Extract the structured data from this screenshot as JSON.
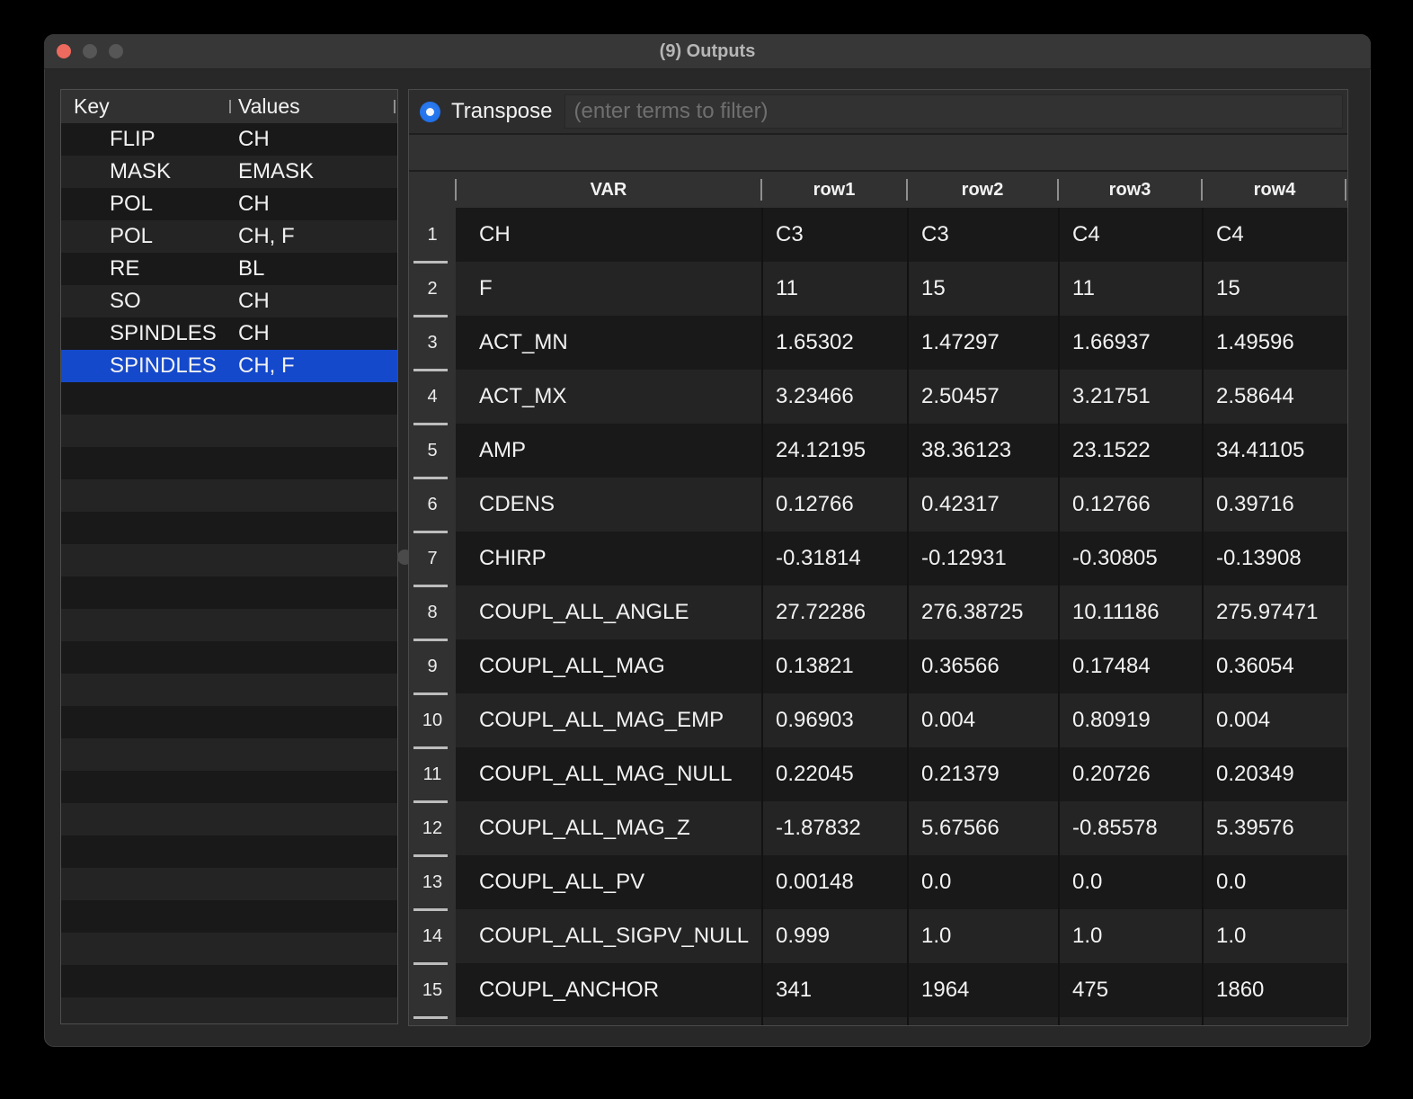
{
  "window": {
    "title": "(9) Outputs"
  },
  "left_panel": {
    "columns": [
      "Key",
      "Values"
    ],
    "rows": [
      {
        "key": "FLIP",
        "values": "CH",
        "selected": false
      },
      {
        "key": "MASK",
        "values": "EMASK",
        "selected": false
      },
      {
        "key": "POL",
        "values": "CH",
        "selected": false
      },
      {
        "key": "POL",
        "values": "CH, F",
        "selected": false
      },
      {
        "key": "RE",
        "values": "BL",
        "selected": false
      },
      {
        "key": "SO",
        "values": "CH",
        "selected": false
      },
      {
        "key": "SPINDLES",
        "values": "CH",
        "selected": false
      },
      {
        "key": "SPINDLES",
        "values": "CH, F",
        "selected": true
      }
    ]
  },
  "toolbar": {
    "transpose_label": "Transpose",
    "transpose_selected": true,
    "filter_value": "",
    "filter_placeholder": "(enter terms to filter)"
  },
  "table": {
    "columns": [
      "VAR",
      "row1",
      "row2",
      "row3",
      "row4"
    ],
    "rows": [
      {
        "n": "1",
        "var": "CH",
        "values": [
          "C3",
          "C3",
          "C4",
          "C4"
        ]
      },
      {
        "n": "2",
        "var": "F",
        "values": [
          "11",
          "15",
          "11",
          "15"
        ]
      },
      {
        "n": "3",
        "var": "ACT_MN",
        "values": [
          "1.65302",
          "1.47297",
          "1.66937",
          "1.49596"
        ]
      },
      {
        "n": "4",
        "var": "ACT_MX",
        "values": [
          "3.23466",
          "2.50457",
          "3.21751",
          "2.58644"
        ]
      },
      {
        "n": "5",
        "var": "AMP",
        "values": [
          "24.12195",
          "38.36123",
          "23.1522",
          "34.41105"
        ]
      },
      {
        "n": "6",
        "var": "CDENS",
        "values": [
          "0.12766",
          "0.42317",
          "0.12766",
          "0.39716"
        ]
      },
      {
        "n": "7",
        "var": "CHIRP",
        "values": [
          "-0.31814",
          "-0.12931",
          "-0.30805",
          "-0.13908"
        ]
      },
      {
        "n": "8",
        "var": "COUPL_ALL_ANGLE",
        "values": [
          "27.72286",
          "276.38725",
          "10.11186",
          "275.97471"
        ]
      },
      {
        "n": "9",
        "var": "COUPL_ALL_MAG",
        "values": [
          "0.13821",
          "0.36566",
          "0.17484",
          "0.36054"
        ]
      },
      {
        "n": "10",
        "var": "COUPL_ALL_MAG_EMP",
        "values": [
          "0.96903",
          "0.004",
          "0.80919",
          "0.004"
        ]
      },
      {
        "n": "11",
        "var": "COUPL_ALL_MAG_NULL",
        "values": [
          "0.22045",
          "0.21379",
          "0.20726",
          "0.20349"
        ]
      },
      {
        "n": "12",
        "var": "COUPL_ALL_MAG_Z",
        "values": [
          "-1.87832",
          "5.67566",
          "-0.85578",
          "5.39576"
        ]
      },
      {
        "n": "13",
        "var": "COUPL_ALL_PV",
        "values": [
          "0.00148",
          "0.0",
          "0.0",
          "0.0"
        ]
      },
      {
        "n": "14",
        "var": "COUPL_ALL_SIGPV_NULL",
        "values": [
          "0.999",
          "1.0",
          "1.0",
          "1.0"
        ]
      },
      {
        "n": "15",
        "var": "COUPL_ANCHOR",
        "values": [
          "341",
          "1964",
          "475",
          "1860"
        ]
      }
    ]
  },
  "colors": {
    "selection_blue": "#1549cb",
    "radio_blue": "#1c6ce8",
    "close_red": "#ec6a5e",
    "window_bg": "#282828",
    "titlebar_bg": "#373737",
    "header_bg": "#313131",
    "row_dark": "#191919",
    "row_light": "#242424"
  }
}
